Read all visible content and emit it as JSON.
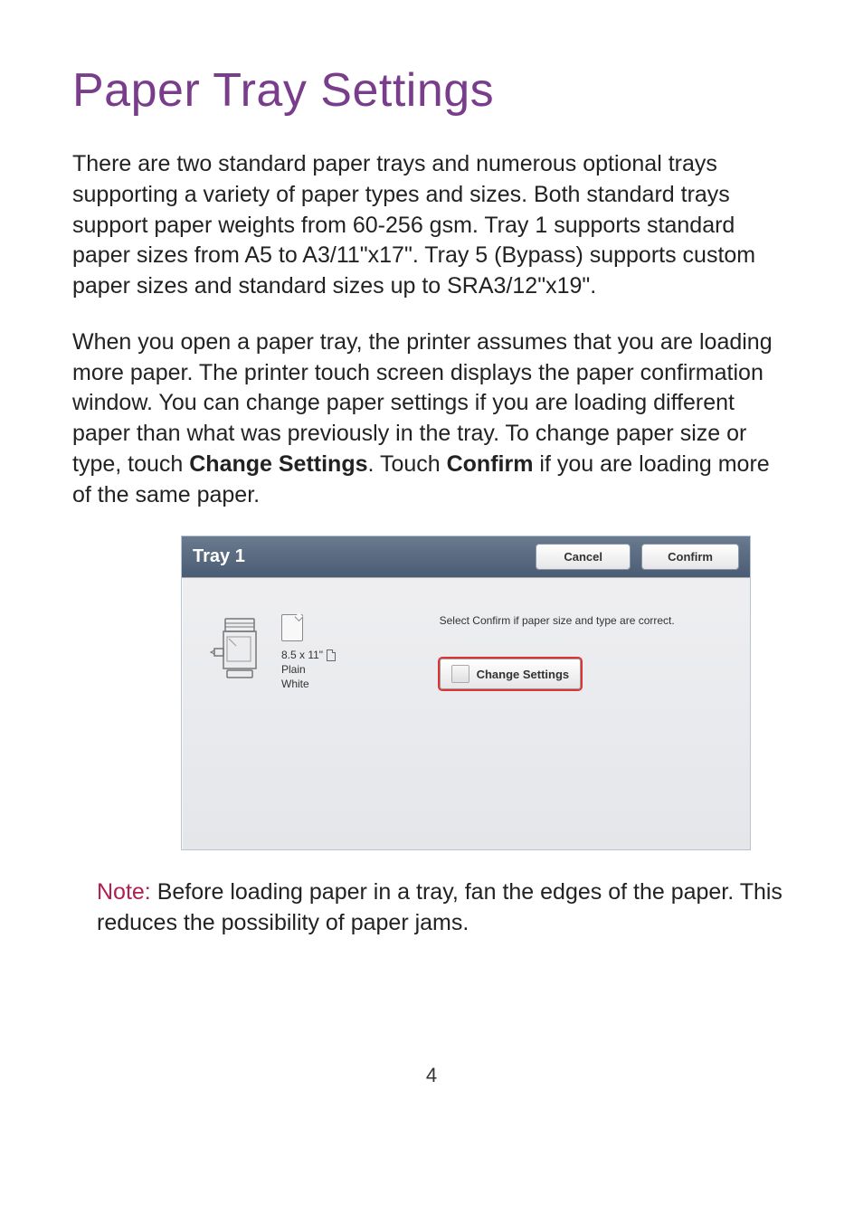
{
  "title": "Paper Tray Settings",
  "paragraph1": {
    "text": "There are two standard paper trays and numerous optional trays supporting a variety of paper types and sizes. Both standard trays support paper weights from 60-256 gsm. Tray 1 supports standard paper sizes from A5 to A3/11\"x17\". Tray 5 (Bypass) supports custom paper sizes and standard sizes up to SRA3/12\"x19\"."
  },
  "paragraph2": {
    "part1": "When you open a paper tray, the printer assumes that you are loading more paper. The printer touch screen displays the paper confirmation window. You can change paper settings if you are loading different paper than what was previously in the tray. To change paper size or type, touch ",
    "bold1": "Change Settings",
    "part2": ". Touch ",
    "bold2": "Confirm",
    "part3": " if you are loading more of the same paper."
  },
  "dialog": {
    "title": "Tray 1",
    "cancel": "Cancel",
    "confirm": "Confirm",
    "paperSize": "8.5 x 11\"",
    "paperType": "Plain",
    "paperColor": "White",
    "instruction": "Select Confirm if paper size and type are correct.",
    "changeSettings": "Change Settings"
  },
  "note": {
    "label": "Note:",
    "text": " Before loading paper in a tray, fan the edges of the paper. This reduces the possibility of paper jams."
  },
  "pageNumber": "4"
}
